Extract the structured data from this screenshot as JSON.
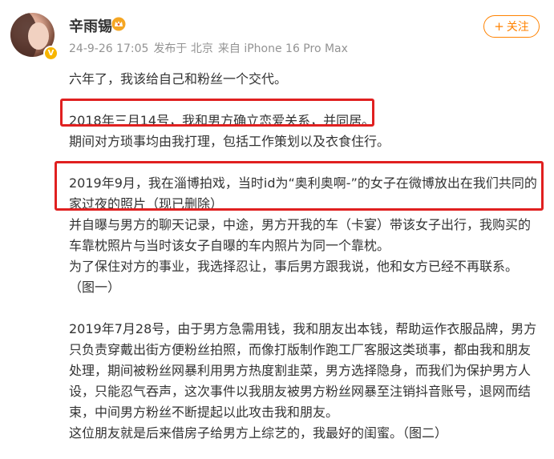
{
  "user": {
    "name": "辛雨锡",
    "badge": "V"
  },
  "post_meta": {
    "date": "24-9-26 17:05",
    "published_from": "发布于 北京",
    "source": "来自 iPhone 16 Pro Max"
  },
  "follow": {
    "label": "关注"
  },
  "content": {
    "p1": "六年了，我该给自己和粉丝一个交代。",
    "p2": "2018年三月14号，我和男方确立恋爱关系，并同居。",
    "p3": "期间对方琐事均由我打理，包括工作策划以及衣食住行。",
    "p4a": "2019年9月，我在淄博拍戏，当时id为“奥利奥啊-”的女子在微博放出在我们共同的",
    "p4b": "家过夜的照片（现已删除）",
    "p5a": "并自曝与男方的聊天记录，中途，男方开我的车（卡宴）带该女子出行，我购买的",
    "p5b": "车靠枕照片与当时该女子自曝的车内照片为同一个靠枕。",
    "p6": "为了保住对方的事业，我选择忍让，事后男方跟我说，他和女方已经不再联系。",
    "p7": "（图一）",
    "p8a": "2019年7月28号，由于男方急需用钱，我和朋友出本钱，帮助运作衣服品牌，男方",
    "p8b": "只负责穿戴出街方便粉丝拍照，而像打版制作跑工厂客服这类琐事，都由我和朋友",
    "p8c": "处理，期间被粉丝网暴利用男方热度割韭菜，男方选择隐身，而我们为保护男方人",
    "p8d": "设，只能忍气吞声，这次事件以我朋友被男方粉丝网暴至注销抖音账号，退网而结",
    "p8e": "束，中间男方粉丝不断提起以此攻击我和朋友。",
    "p9": "这位朋友就是后来借房子给男方上综艺的，我最好的闺蜜。（图二）"
  },
  "colors": {
    "accent": "#ff8200",
    "highlight": "#e02020",
    "meta_text": "#939393",
    "body_text": "#333333"
  },
  "icons": [
    "avatar",
    "verified-badge-icon",
    "crown-icon",
    "plus-icon"
  ]
}
